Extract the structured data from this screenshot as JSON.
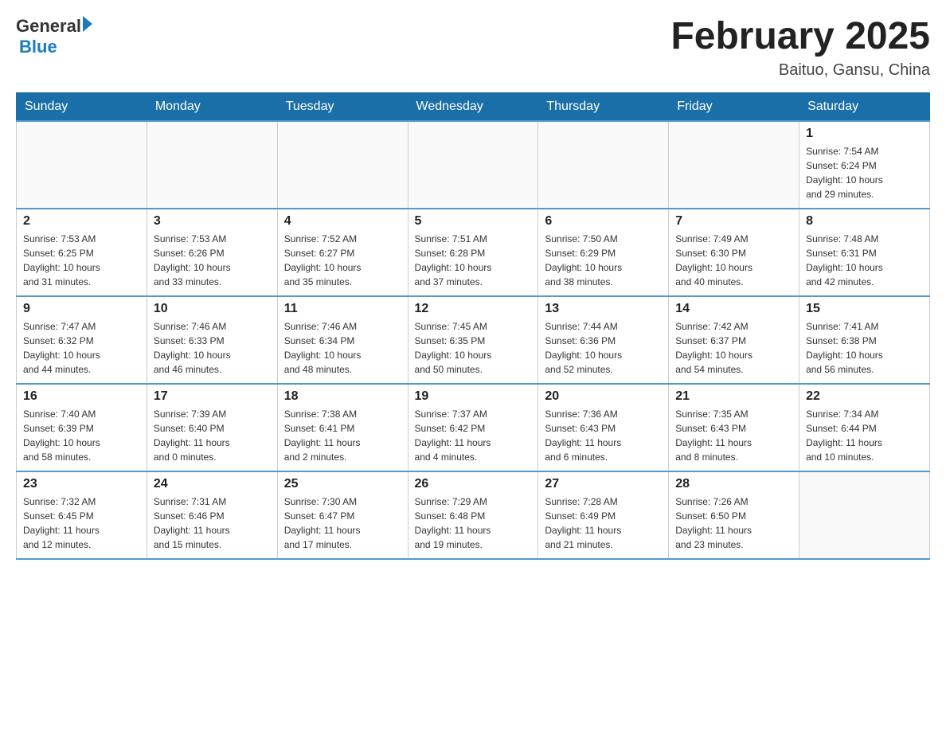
{
  "header": {
    "logo_general": "General",
    "logo_blue": "Blue",
    "title": "February 2025",
    "subtitle": "Baituo, Gansu, China"
  },
  "weekdays": [
    "Sunday",
    "Monday",
    "Tuesday",
    "Wednesday",
    "Thursday",
    "Friday",
    "Saturday"
  ],
  "weeks": [
    [
      {
        "day": "",
        "info": ""
      },
      {
        "day": "",
        "info": ""
      },
      {
        "day": "",
        "info": ""
      },
      {
        "day": "",
        "info": ""
      },
      {
        "day": "",
        "info": ""
      },
      {
        "day": "",
        "info": ""
      },
      {
        "day": "1",
        "info": "Sunrise: 7:54 AM\nSunset: 6:24 PM\nDaylight: 10 hours\nand 29 minutes."
      }
    ],
    [
      {
        "day": "2",
        "info": "Sunrise: 7:53 AM\nSunset: 6:25 PM\nDaylight: 10 hours\nand 31 minutes."
      },
      {
        "day": "3",
        "info": "Sunrise: 7:53 AM\nSunset: 6:26 PM\nDaylight: 10 hours\nand 33 minutes."
      },
      {
        "day": "4",
        "info": "Sunrise: 7:52 AM\nSunset: 6:27 PM\nDaylight: 10 hours\nand 35 minutes."
      },
      {
        "day": "5",
        "info": "Sunrise: 7:51 AM\nSunset: 6:28 PM\nDaylight: 10 hours\nand 37 minutes."
      },
      {
        "day": "6",
        "info": "Sunrise: 7:50 AM\nSunset: 6:29 PM\nDaylight: 10 hours\nand 38 minutes."
      },
      {
        "day": "7",
        "info": "Sunrise: 7:49 AM\nSunset: 6:30 PM\nDaylight: 10 hours\nand 40 minutes."
      },
      {
        "day": "8",
        "info": "Sunrise: 7:48 AM\nSunset: 6:31 PM\nDaylight: 10 hours\nand 42 minutes."
      }
    ],
    [
      {
        "day": "9",
        "info": "Sunrise: 7:47 AM\nSunset: 6:32 PM\nDaylight: 10 hours\nand 44 minutes."
      },
      {
        "day": "10",
        "info": "Sunrise: 7:46 AM\nSunset: 6:33 PM\nDaylight: 10 hours\nand 46 minutes."
      },
      {
        "day": "11",
        "info": "Sunrise: 7:46 AM\nSunset: 6:34 PM\nDaylight: 10 hours\nand 48 minutes."
      },
      {
        "day": "12",
        "info": "Sunrise: 7:45 AM\nSunset: 6:35 PM\nDaylight: 10 hours\nand 50 minutes."
      },
      {
        "day": "13",
        "info": "Sunrise: 7:44 AM\nSunset: 6:36 PM\nDaylight: 10 hours\nand 52 minutes."
      },
      {
        "day": "14",
        "info": "Sunrise: 7:42 AM\nSunset: 6:37 PM\nDaylight: 10 hours\nand 54 minutes."
      },
      {
        "day": "15",
        "info": "Sunrise: 7:41 AM\nSunset: 6:38 PM\nDaylight: 10 hours\nand 56 minutes."
      }
    ],
    [
      {
        "day": "16",
        "info": "Sunrise: 7:40 AM\nSunset: 6:39 PM\nDaylight: 10 hours\nand 58 minutes."
      },
      {
        "day": "17",
        "info": "Sunrise: 7:39 AM\nSunset: 6:40 PM\nDaylight: 11 hours\nand 0 minutes."
      },
      {
        "day": "18",
        "info": "Sunrise: 7:38 AM\nSunset: 6:41 PM\nDaylight: 11 hours\nand 2 minutes."
      },
      {
        "day": "19",
        "info": "Sunrise: 7:37 AM\nSunset: 6:42 PM\nDaylight: 11 hours\nand 4 minutes."
      },
      {
        "day": "20",
        "info": "Sunrise: 7:36 AM\nSunset: 6:43 PM\nDaylight: 11 hours\nand 6 minutes."
      },
      {
        "day": "21",
        "info": "Sunrise: 7:35 AM\nSunset: 6:43 PM\nDaylight: 11 hours\nand 8 minutes."
      },
      {
        "day": "22",
        "info": "Sunrise: 7:34 AM\nSunset: 6:44 PM\nDaylight: 11 hours\nand 10 minutes."
      }
    ],
    [
      {
        "day": "23",
        "info": "Sunrise: 7:32 AM\nSunset: 6:45 PM\nDaylight: 11 hours\nand 12 minutes."
      },
      {
        "day": "24",
        "info": "Sunrise: 7:31 AM\nSunset: 6:46 PM\nDaylight: 11 hours\nand 15 minutes."
      },
      {
        "day": "25",
        "info": "Sunrise: 7:30 AM\nSunset: 6:47 PM\nDaylight: 11 hours\nand 17 minutes."
      },
      {
        "day": "26",
        "info": "Sunrise: 7:29 AM\nSunset: 6:48 PM\nDaylight: 11 hours\nand 19 minutes."
      },
      {
        "day": "27",
        "info": "Sunrise: 7:28 AM\nSunset: 6:49 PM\nDaylight: 11 hours\nand 21 minutes."
      },
      {
        "day": "28",
        "info": "Sunrise: 7:26 AM\nSunset: 6:50 PM\nDaylight: 11 hours\nand 23 minutes."
      },
      {
        "day": "",
        "info": ""
      }
    ]
  ]
}
